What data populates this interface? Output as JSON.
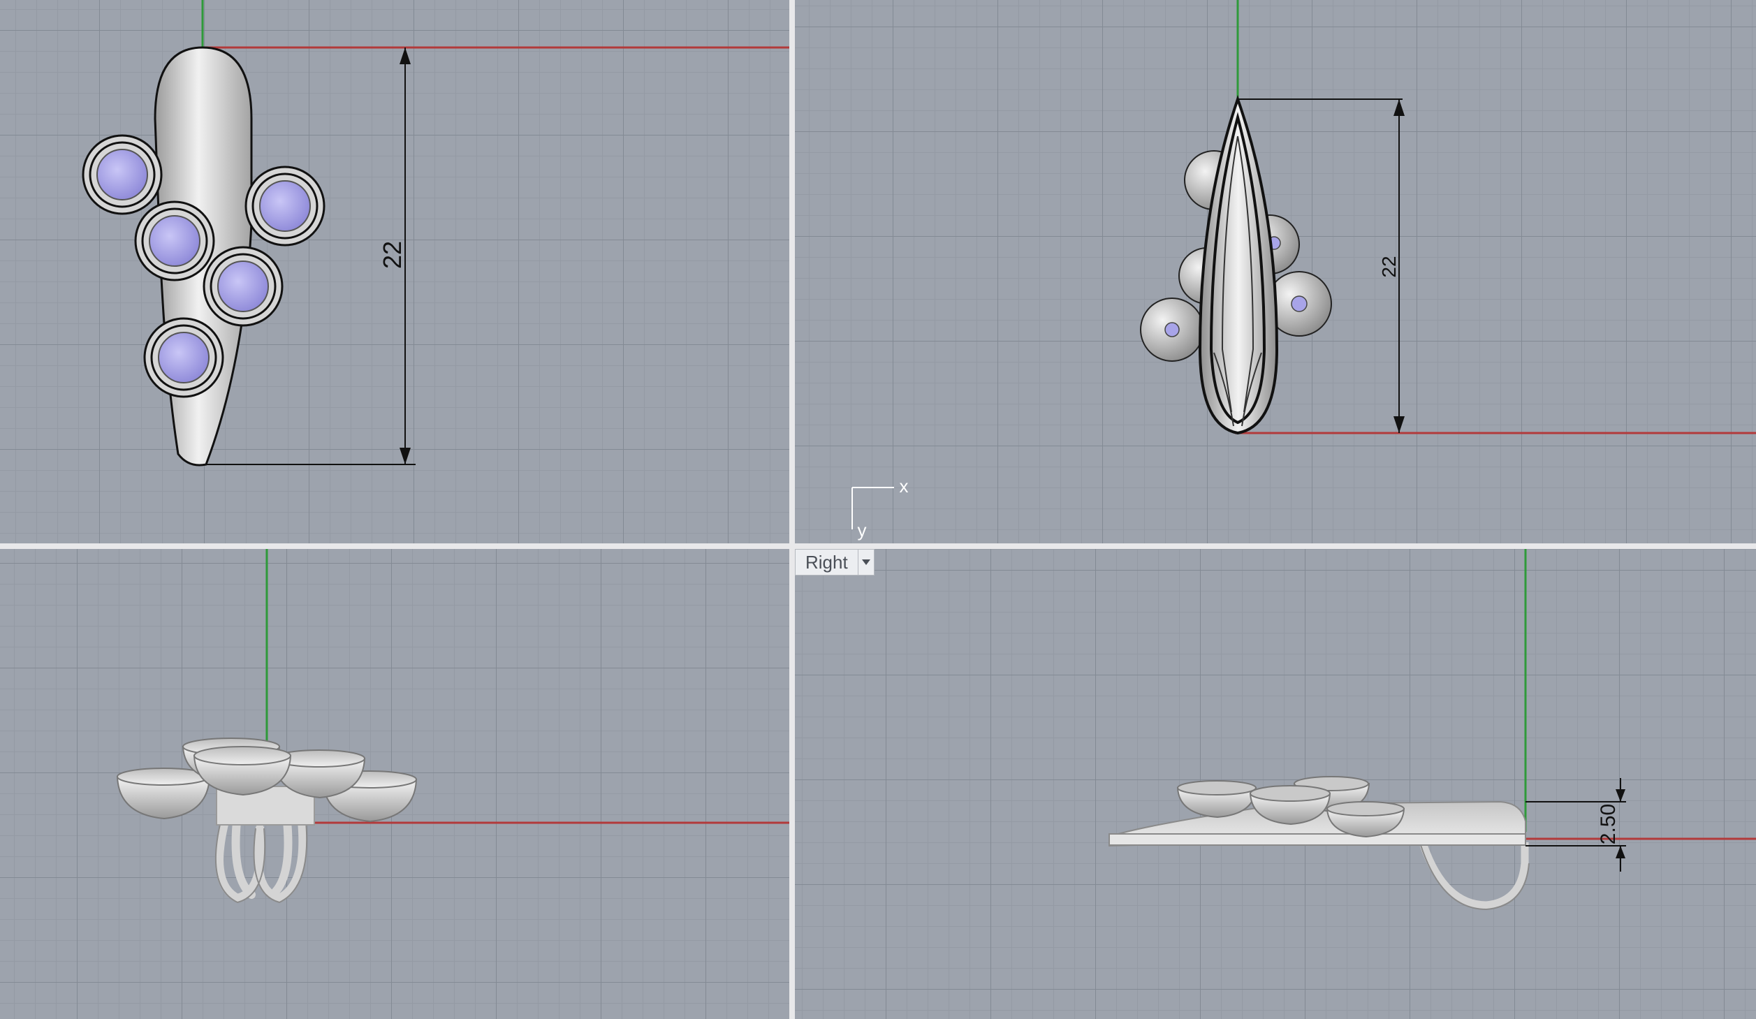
{
  "viewports": {
    "top_left": {
      "dimension": "22"
    },
    "top_right": {
      "dimension": "22",
      "axis_x": "x",
      "axis_y": "y"
    },
    "bottom_left": {},
    "bottom_right": {
      "title": "Right",
      "dimension": "2.50"
    }
  },
  "colors": {
    "viewport_bg": "#9da3ad",
    "grid_major": "#838a94",
    "grid_minor": "#949aa4",
    "x_axis": "#b23a3a",
    "y_axis": "#2f9a3a",
    "gem": "#a8a4e8",
    "metal": "#d8d8d8"
  }
}
